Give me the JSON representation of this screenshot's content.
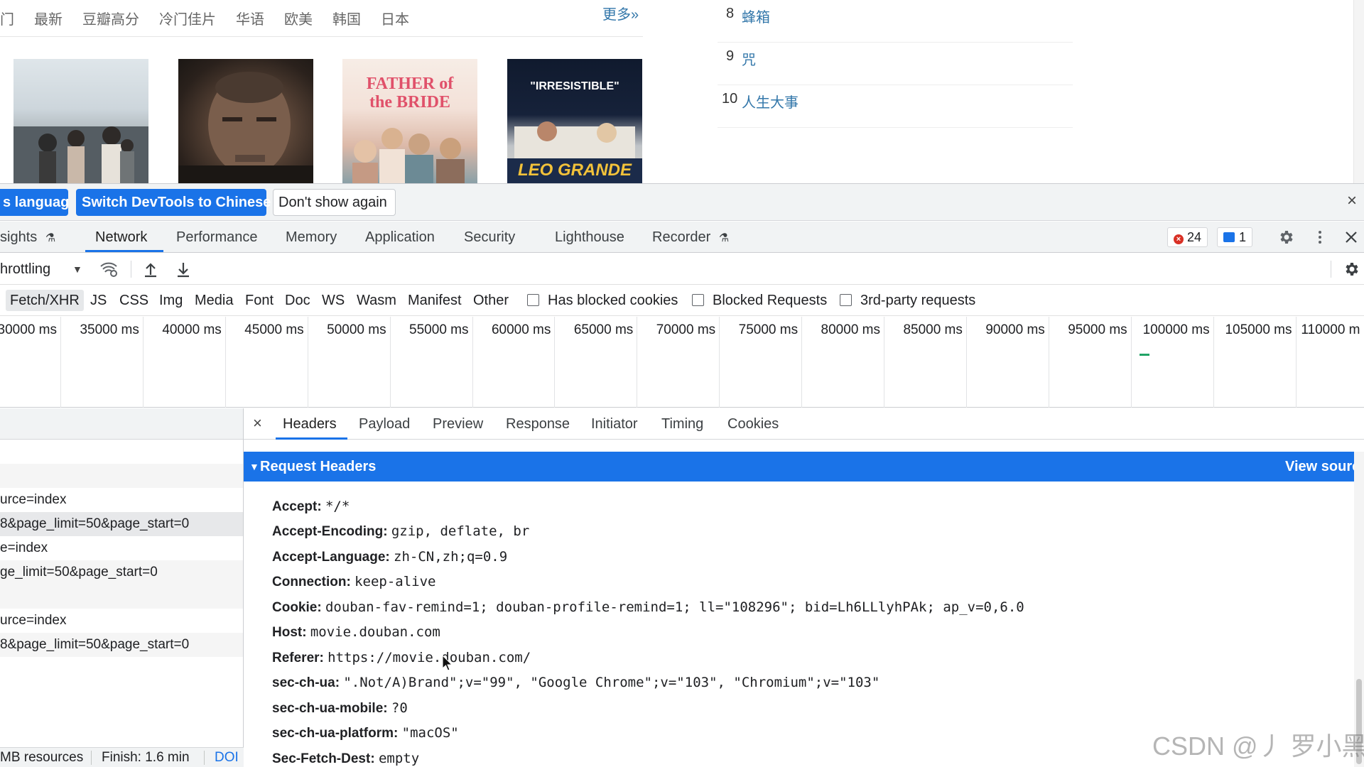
{
  "webpage": {
    "nav_tabs": [
      "门",
      "最新",
      "豆瓣高分",
      "冷门佳片",
      "华语",
      "欧美",
      "韩国",
      "日本"
    ],
    "more_label": "更多»",
    "posters": [
      {
        "caption": ""
      },
      {
        "caption": ""
      },
      {
        "caption": "FATHER of the BRIDE"
      },
      {
        "caption": "\"IRRESISTIBLE\"",
        "caption2": "LEO GRANDE"
      }
    ],
    "ranking": [
      {
        "num": "8",
        "title": "蜂箱"
      },
      {
        "num": "9",
        "title": "咒"
      },
      {
        "num": "10",
        "title": "人生大事"
      }
    ]
  },
  "banner": {
    "lang_button": "s language",
    "switch_button": "Switch DevTools to Chinese",
    "dont_show_button": "Don't show again",
    "close_glyph": "×"
  },
  "panel_tabs": {
    "items": [
      "sights",
      "Network",
      "Performance",
      "Memory",
      "Application",
      "Security",
      "Lighthouse",
      "Recorder"
    ],
    "active": "Network",
    "error_count": "24",
    "message_count": "1"
  },
  "network_toolbar": {
    "throttling": "hrottling"
  },
  "filter_bar": {
    "types": [
      "Fetch/XHR",
      "JS",
      "CSS",
      "Img",
      "Media",
      "Font",
      "Doc",
      "WS",
      "Wasm",
      "Manifest",
      "Other"
    ],
    "selected": "Fetch/XHR",
    "checkboxes": [
      "Has blocked cookies",
      "Blocked Requests",
      "3rd-party requests"
    ]
  },
  "timeline": {
    "ticks": [
      "30000 ms",
      "35000 ms",
      "40000 ms",
      "45000 ms",
      "50000 ms",
      "55000 ms",
      "60000 ms",
      "65000 ms",
      "70000 ms",
      "75000 ms",
      "80000 ms",
      "85000 ms",
      "90000 ms",
      "95000 ms",
      "100000 ms",
      "105000 ms",
      "110000 m"
    ]
  },
  "request_list": {
    "rows": [
      "",
      "",
      "urce=index",
      "8&page_limit=50&page_start=0",
      "e=index",
      "ge_limit=50&page_start=0",
      "",
      "urce=index",
      "8&page_limit=50&page_start=0"
    ]
  },
  "status_bar": {
    "resources": "MB resources",
    "finish": "Finish: 1.6 min",
    "dom": "DOI"
  },
  "detail_tabs": {
    "close_glyph": "×",
    "items": [
      "Headers",
      "Payload",
      "Preview",
      "Response",
      "Initiator",
      "Timing",
      "Cookies"
    ],
    "active": "Headers"
  },
  "request_headers": {
    "title": "Request Headers",
    "view_source": "View sourc",
    "rows": [
      {
        "name": "Accept:",
        "value": "*/*"
      },
      {
        "name": "Accept-Encoding:",
        "value": "gzip, deflate, br"
      },
      {
        "name": "Accept-Language:",
        "value": "zh-CN,zh;q=0.9"
      },
      {
        "name": "Connection:",
        "value": "keep-alive"
      },
      {
        "name": "Cookie:",
        "value": "douban-fav-remind=1; douban-profile-remind=1; ll=\"108296\"; bid=Lh6LLlyhPAk; ap_v=0,6.0"
      },
      {
        "name": "Host:",
        "value": "movie.douban.com"
      },
      {
        "name": "Referer:",
        "value": "https://movie.douban.com/"
      },
      {
        "name": "sec-ch-ua:",
        "value": "\".Not/A)Brand\";v=\"99\", \"Google Chrome\";v=\"103\", \"Chromium\";v=\"103\""
      },
      {
        "name": "sec-ch-ua-mobile:",
        "value": "?0"
      },
      {
        "name": "sec-ch-ua-platform:",
        "value": "\"macOS\""
      },
      {
        "name": "Sec-Fetch-Dest:",
        "value": "empty"
      }
    ]
  },
  "watermark": "CSDN @丿 罗小黑",
  "colors": {
    "accent": "#1a73e8",
    "link": "#3377aa",
    "error": "#d93025"
  }
}
